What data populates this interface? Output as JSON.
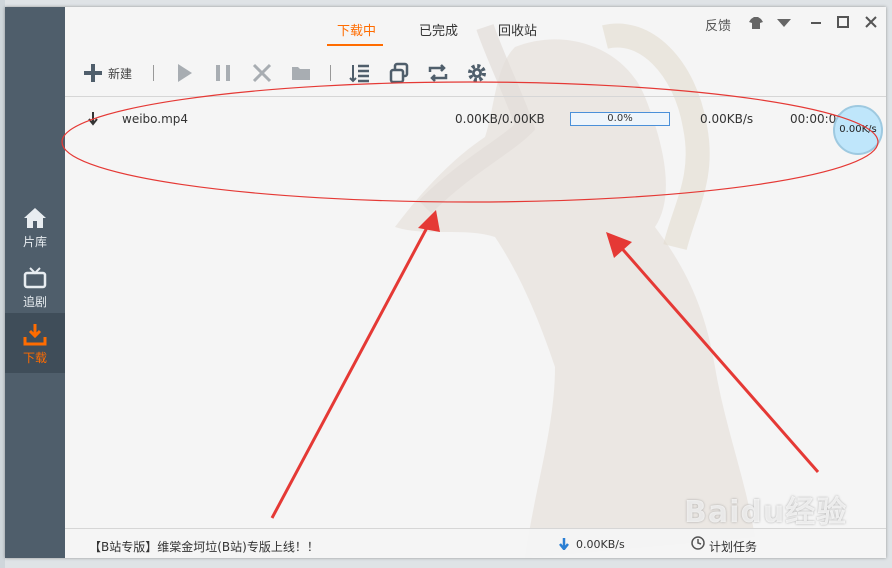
{
  "tabs": [
    "下载中",
    "已完成",
    "回收站"
  ],
  "window_controls": {
    "feedback": "反馈"
  },
  "sidebar": {
    "items": [
      {
        "label": "片库",
        "icon": "home-icon"
      },
      {
        "label": "追剧",
        "icon": "tv-icon"
      },
      {
        "label": "下载",
        "icon": "download-icon"
      }
    ]
  },
  "toolbar": {
    "new_label": "新建"
  },
  "download_row": {
    "filename": "weibo.mp4",
    "size": "0.00KB/0.00KB",
    "progress_text": "0.0%",
    "progress": 0.0,
    "speed": "0.00KB/s",
    "time": "00:00:00"
  },
  "speed_ball": "0.00K/s",
  "statusbar": {
    "notice": "【B站专版】维棠金坷垃(B站)专版上线！！",
    "down_speed": "0.00KB/s",
    "schedule": "计划任务"
  },
  "watermark": "Baidu经验",
  "colors": {
    "accent": "#ff6c00",
    "sidebar": "#4f5e6b",
    "annotation": "#e53935"
  }
}
